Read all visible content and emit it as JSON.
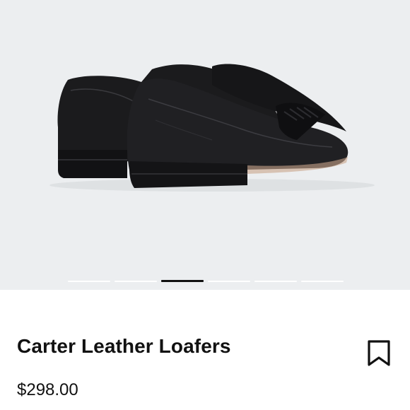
{
  "product": {
    "title": "Carter Leather Loafers",
    "price": "$298.00",
    "image_icon": "black-leather-penny-loafers-image",
    "bookmark_icon": "bookmark-icon"
  },
  "gallery": {
    "page_count": 6,
    "active_index": 2
  },
  "colors": {
    "gallery_background": "#eceef0",
    "text": "#111111",
    "active_indicator": "#111111",
    "inactive_indicator": "#ffffff"
  }
}
